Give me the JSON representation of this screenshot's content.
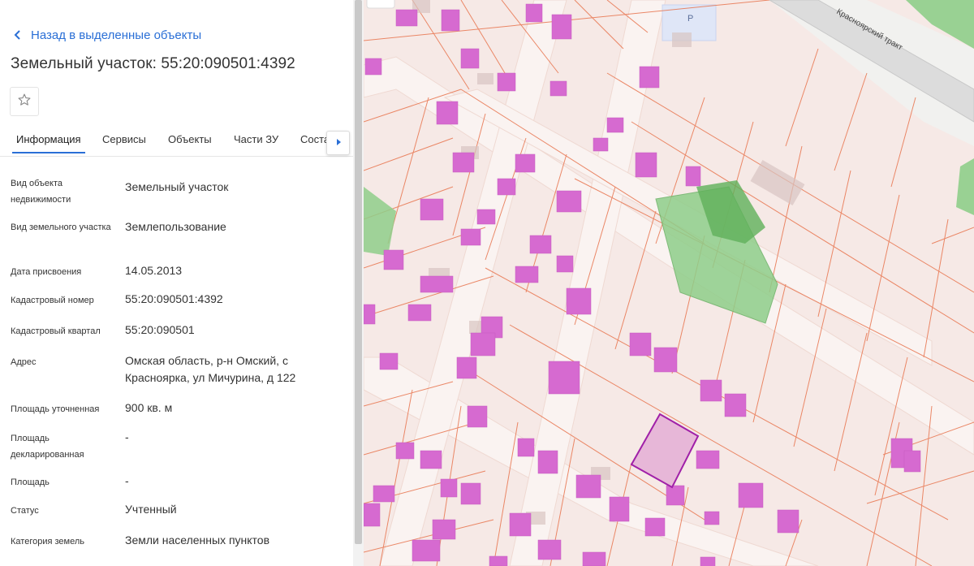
{
  "panel": {
    "back_label": "Назад в выделенные объекты",
    "title": "Земельный участок: 55:20:090501:4392",
    "tabs": [
      {
        "label": "Информация",
        "active": true
      },
      {
        "label": "Сервисы",
        "active": false
      },
      {
        "label": "Объекты",
        "active": false
      },
      {
        "label": "Части ЗУ",
        "active": false
      },
      {
        "label": "Состав",
        "active": false
      }
    ],
    "details": [
      {
        "label": "Вид объекта недвижимости",
        "value": "Земельный участок"
      },
      {
        "label": "Вид земельного участка",
        "value": "Землепользование"
      },
      {
        "label": "Дата присвоения",
        "value": "14.05.2013"
      },
      {
        "label": "Кадастровый номер",
        "value": "55:20:090501:4392"
      },
      {
        "label": "Кадастровый квартал",
        "value": "55:20:090501"
      },
      {
        "label": "Адрес",
        "value": "Омская область, р-н Омский, с Красноярка, ул Мичурина, д 122"
      },
      {
        "label": "Площадь уточненная",
        "value": "900 кв. м"
      },
      {
        "label": "Площадь декларированная",
        "value": "-"
      },
      {
        "label": "Площадь",
        "value": "-"
      },
      {
        "label": "Статус",
        "value": "Учтенный"
      },
      {
        "label": "Категория земель",
        "value": "Земли населенных пунктов"
      }
    ]
  },
  "map": {
    "road_label": "Красноярский тракт",
    "parking_label": "P",
    "colors": {
      "parcel_fill": "#f6e9e6",
      "parcel_border": "#e8754f",
      "building": "#d66ad0",
      "selected_fill": "#e7b7d8",
      "selected_border": "#a020a8",
      "green": "#8fce8a",
      "road": "#dcdcdc"
    }
  },
  "icons": {
    "back": "chevron-left-icon",
    "favorite": "star-icon",
    "tab_scroll": "chevron-right-icon"
  }
}
